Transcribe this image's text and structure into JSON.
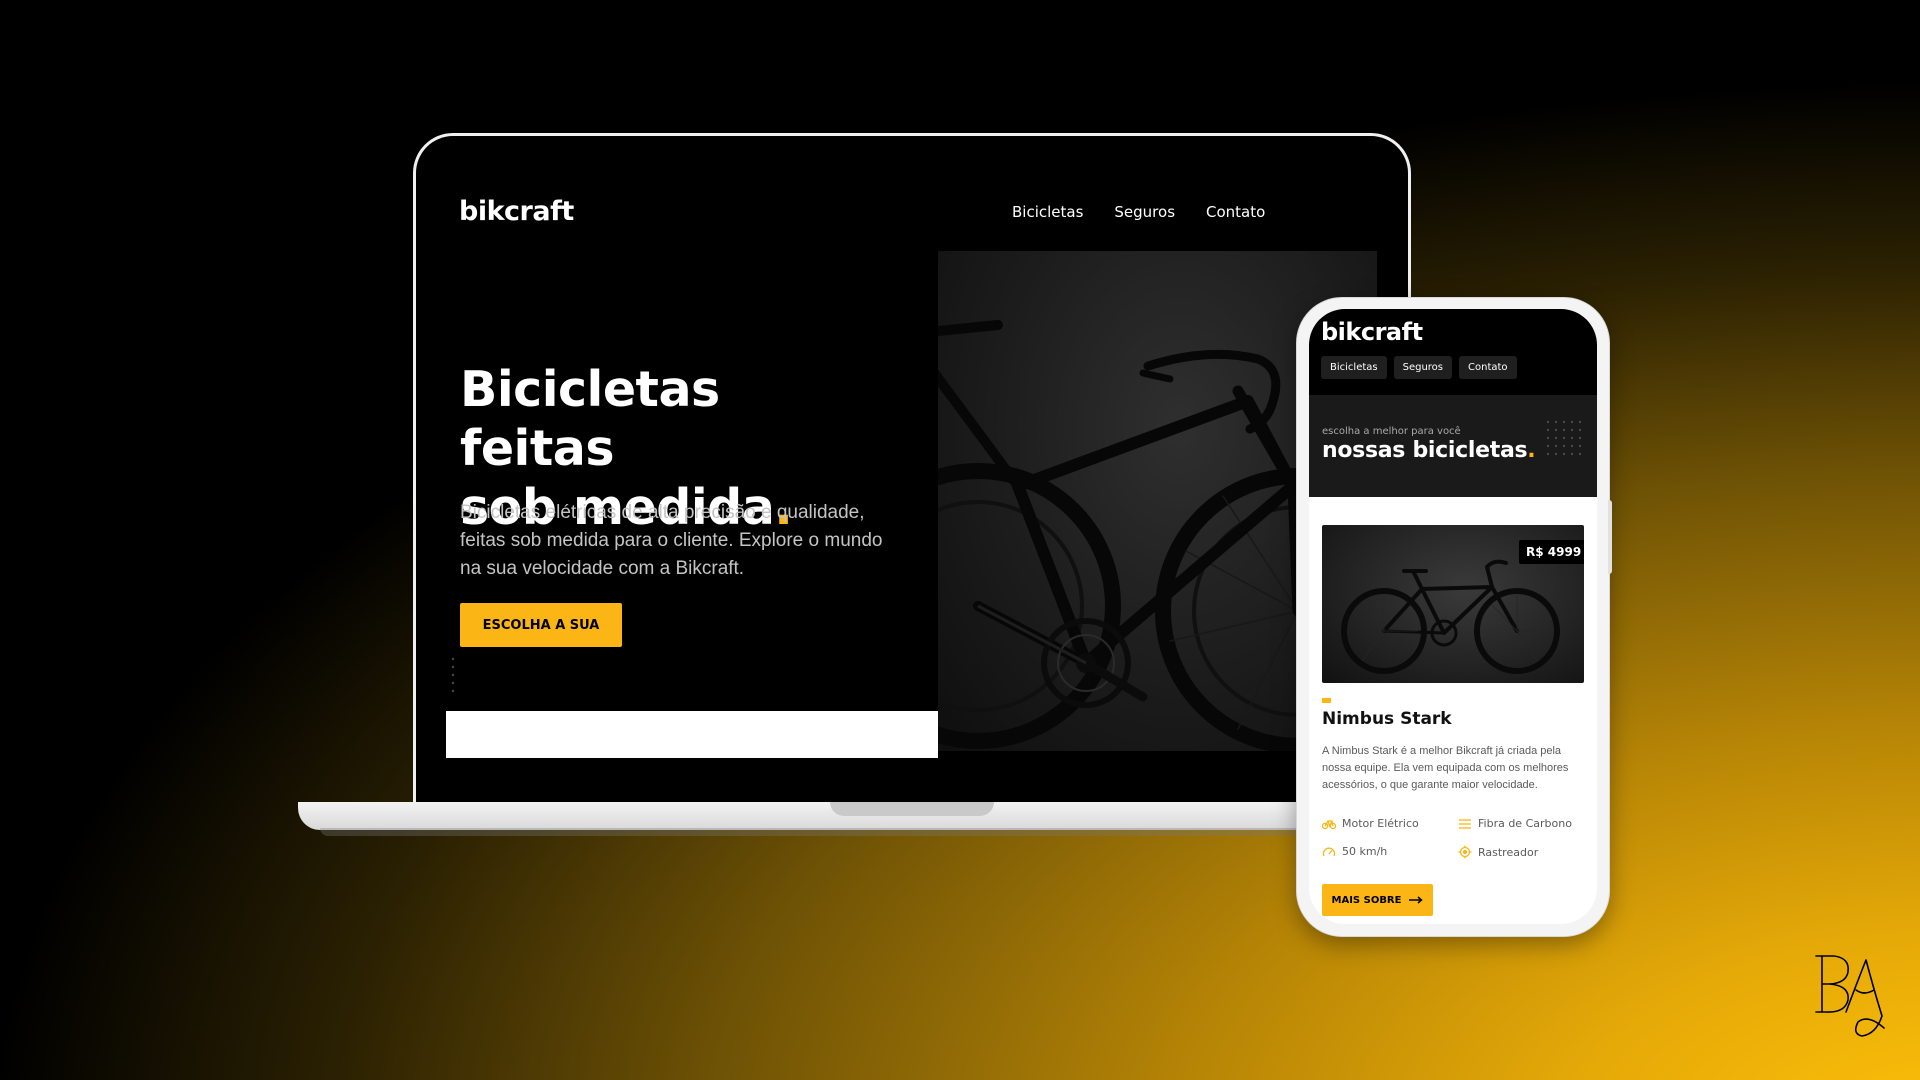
{
  "colors": {
    "accent": "#fbb615",
    "dark": "#000000",
    "light": "#ffffff"
  },
  "desktop": {
    "logo": "bikcraft",
    "nav": [
      "Bicicletas",
      "Seguros",
      "Contato"
    ],
    "hero": {
      "title_line1": "Bicicletas feitas",
      "title_line2": "sob medida",
      "title_dot": ".",
      "text": "Bicicletas elétricas de alta precisão e qualidade, feitas sob medida para o cliente. Explore o mundo na sua velocidade com a Bikcraft.",
      "cta": "ESCOLHA A SUA"
    }
  },
  "mobile": {
    "logo": "bikcraft",
    "nav": [
      "Bicicletas",
      "Seguros",
      "Contato"
    ],
    "hero": {
      "subtitle": "escolha a melhor para você",
      "title": "nossas bicicletas",
      "title_dot": "."
    },
    "product": {
      "price": "R$ 4999",
      "name": "Nimbus Stark",
      "description": "A Nimbus Stark é a melhor Bikcraft já criada pela nossa equipe. Ela vem equipada com os melhores acessórios, o que garante maior velocidade.",
      "specs": [
        {
          "label": "Motor Elétrico",
          "icon": "bike-icon"
        },
        {
          "label": "Fibra de Carbono",
          "icon": "carbon-icon"
        },
        {
          "label": "50 km/h",
          "icon": "speedometer-icon"
        },
        {
          "label": "Rastreador",
          "icon": "tracker-icon"
        }
      ],
      "more_button": "MAIS SOBRE"
    }
  },
  "brand_logo_text": "BA"
}
